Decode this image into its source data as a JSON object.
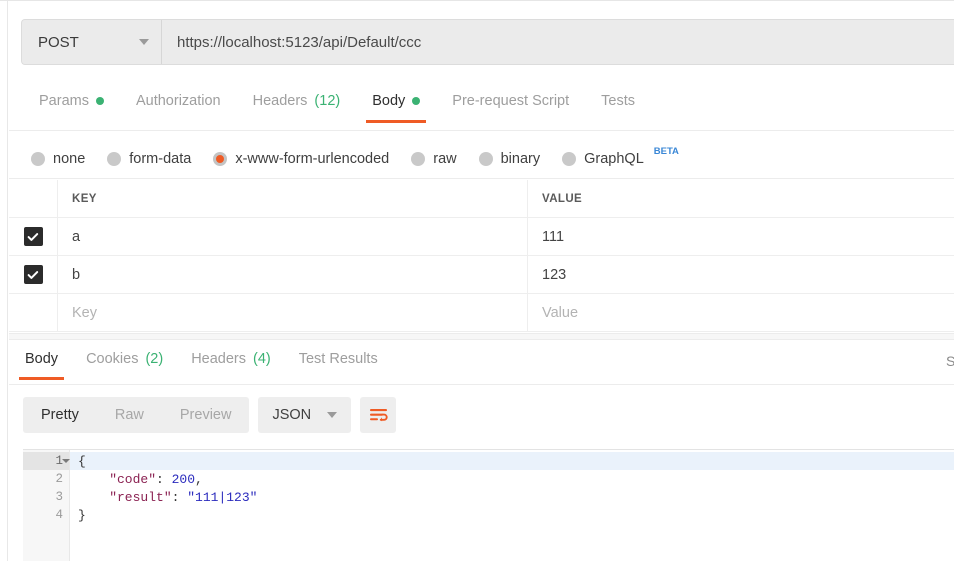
{
  "request": {
    "method": "POST",
    "method_caret": "chevron-down-icon",
    "url": "https://localhost:5123/api/Default/ccc",
    "tabs": [
      {
        "label": "Params",
        "count": "",
        "dot": true,
        "active": false
      },
      {
        "label": "Authorization",
        "count": "",
        "dot": false,
        "active": false
      },
      {
        "label": "Headers",
        "count": "(12)",
        "dot": false,
        "active": false
      },
      {
        "label": "Body",
        "count": "",
        "dot": true,
        "active": true
      },
      {
        "label": "Pre-request Script",
        "count": "",
        "dot": false,
        "active": false
      },
      {
        "label": "Tests",
        "count": "",
        "dot": false,
        "active": false
      }
    ],
    "body_types": [
      {
        "label": "none",
        "selected": false,
        "badge": ""
      },
      {
        "label": "form-data",
        "selected": false,
        "badge": ""
      },
      {
        "label": "x-www-form-urlencoded",
        "selected": true,
        "badge": ""
      },
      {
        "label": "raw",
        "selected": false,
        "badge": ""
      },
      {
        "label": "binary",
        "selected": false,
        "badge": ""
      },
      {
        "label": "GraphQL",
        "selected": false,
        "badge": "BETA"
      }
    ],
    "table": {
      "headers": {
        "key": "KEY",
        "value": "VALUE"
      },
      "rows": [
        {
          "checked": true,
          "key": "a",
          "value": "111",
          "placeholder": false
        },
        {
          "checked": true,
          "key": "b",
          "value": "123",
          "placeholder": false
        }
      ],
      "new_row": {
        "key_placeholder": "Key",
        "value_placeholder": "Value"
      }
    }
  },
  "response": {
    "tabs": [
      {
        "label": "Body",
        "count": "",
        "active": true
      },
      {
        "label": "Cookies",
        "count": "(2)",
        "active": false
      },
      {
        "label": "Headers",
        "count": "(4)",
        "active": false
      },
      {
        "label": "Test Results",
        "count": "",
        "active": false
      }
    ],
    "status_fragment": "S",
    "view_modes": [
      {
        "label": "Pretty",
        "active": true
      },
      {
        "label": "Raw",
        "active": false
      },
      {
        "label": "Preview",
        "active": false
      }
    ],
    "format": "JSON",
    "format_caret": "chevron-down-icon",
    "wrap_icon": "word-wrap-icon",
    "code": {
      "lines": [
        {
          "num": "1",
          "foldable": true,
          "current": true,
          "tokens": [
            {
              "t": "{",
              "c": "p"
            }
          ]
        },
        {
          "num": "2",
          "foldable": false,
          "current": false,
          "tokens": [
            {
              "t": "    \"code\"",
              "c": "k"
            },
            {
              "t": ": ",
              "c": "p"
            },
            {
              "t": "200",
              "c": "n"
            },
            {
              "t": ",",
              "c": "p"
            }
          ]
        },
        {
          "num": "3",
          "foldable": false,
          "current": false,
          "tokens": [
            {
              "t": "    \"result\"",
              "c": "k"
            },
            {
              "t": ": ",
              "c": "p"
            },
            {
              "t": "\"111|123\"",
              "c": "s"
            }
          ]
        },
        {
          "num": "4",
          "foldable": false,
          "current": false,
          "tokens": [
            {
              "t": "}",
              "c": "p"
            }
          ]
        }
      ]
    }
  },
  "colors": {
    "accent": "#ef5b25",
    "green": "#3bb273",
    "blue": "#3a87d6",
    "json_key": "#8b2252",
    "json_value": "#2b2bbd"
  }
}
